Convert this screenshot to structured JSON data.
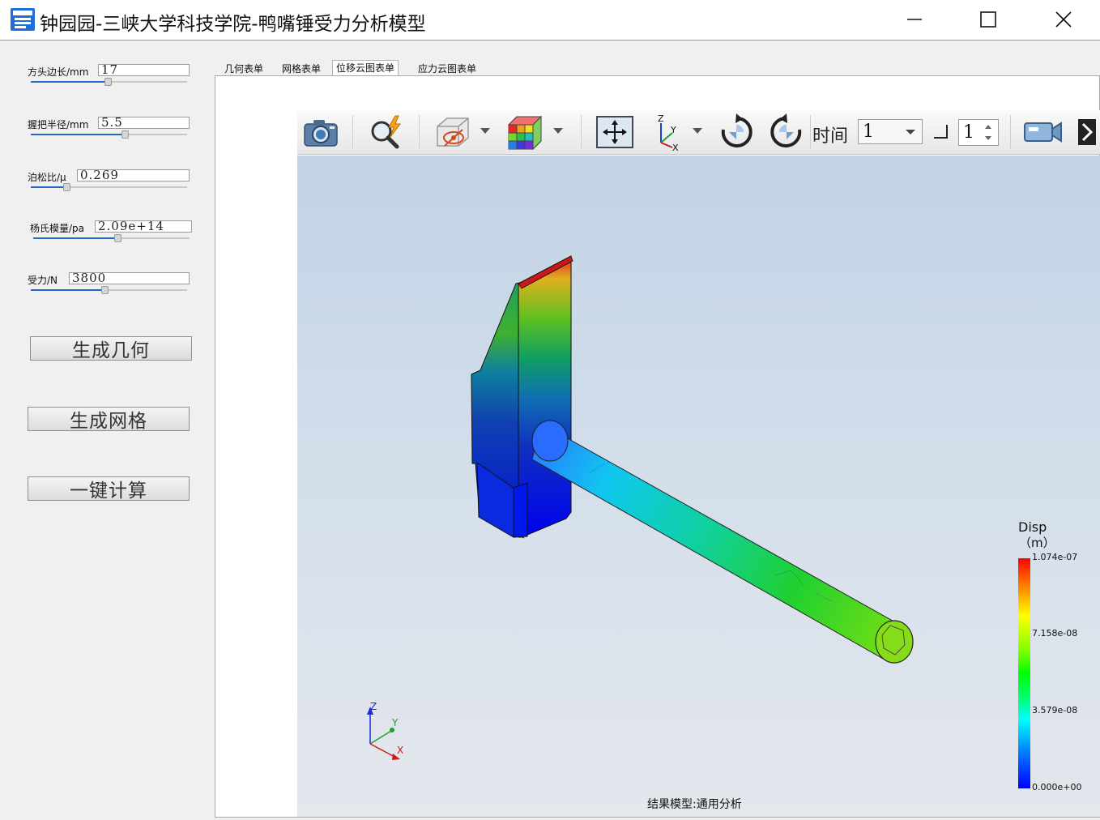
{
  "window": {
    "title": "钟园园-三峡大学科技学院-鸭嘴锤受力分析模型",
    "controls": [
      "minimize",
      "maximize",
      "close"
    ]
  },
  "params": [
    {
      "label": "方头边长/mm",
      "value": "17",
      "slider": 0.49
    },
    {
      "label": "握把半径/mm",
      "value": "5.5",
      "slider": 0.6
    },
    {
      "label": "泊松比/μ",
      "value": "0.269",
      "slider": 0.23
    },
    {
      "label": "杨氏模量/pa",
      "value": "2.09e+14",
      "slider": 0.54
    },
    {
      "label": "受力/N",
      "value": "3800",
      "slider": 0.47
    }
  ],
  "buttons": {
    "gen_geometry": "生成几何",
    "gen_mesh": "生成网格",
    "compute": "一键计算"
  },
  "tabs": [
    {
      "label": "几何表单",
      "active": false
    },
    {
      "label": "网格表单",
      "active": false
    },
    {
      "label": "位移云图表单",
      "active": true
    },
    {
      "label": "应力云图表单",
      "active": false
    }
  ],
  "toolbar": {
    "icons": [
      "camera-icon",
      "magnify-icon",
      "hide-object-icon",
      "color-grid-icon",
      "fit-view-icon",
      "axis-view-icon",
      "rotate-cw-icon",
      "rotate-ccw-icon",
      "video-camera-icon",
      "more-icon"
    ],
    "time_label": "时间",
    "time_value": "1",
    "step_value": "1"
  },
  "viewport": {
    "status": "结果模型:通用分析",
    "triad": {
      "z": "Z",
      "y": "Y",
      "x": "X"
    }
  },
  "legend": {
    "title": "Disp",
    "unit": "（m）",
    "max": "1.074e-07",
    "v2": "7.158e-08",
    "v1": "3.579e-08",
    "min": "0.000e+00",
    "colors": [
      "#ff0000",
      "#ffff00",
      "#00ff00",
      "#00ffff",
      "#0000ff"
    ]
  }
}
